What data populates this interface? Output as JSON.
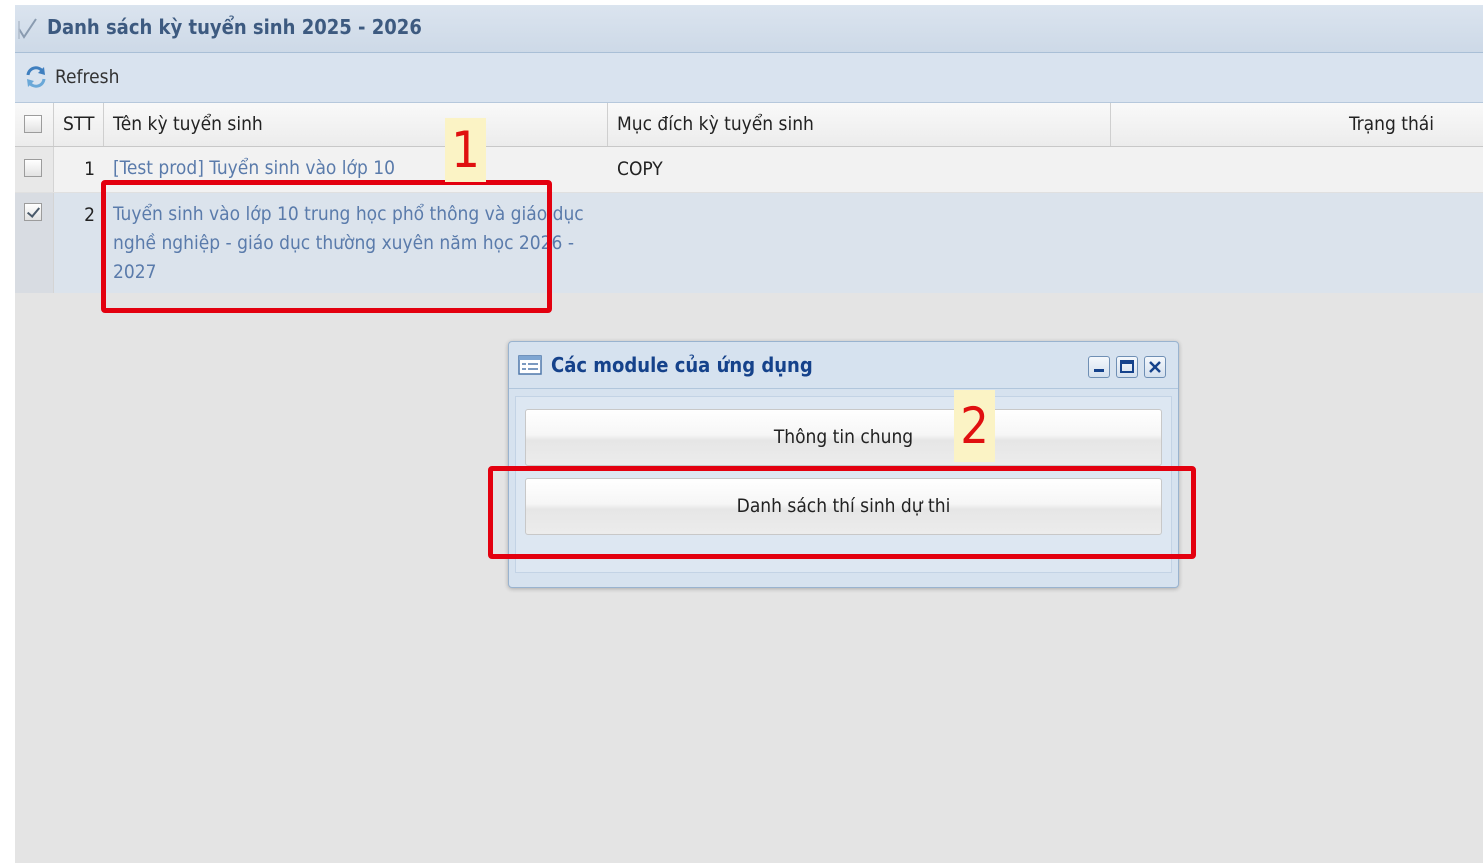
{
  "panel": {
    "title": "Danh sách kỳ tuyển sinh 2025 - 2026",
    "refresh_label": "Refresh"
  },
  "grid": {
    "columns": [
      "STT",
      "Tên kỳ tuyển sinh",
      "Mục đích kỳ tuyển sinh",
      "Trạng thái"
    ],
    "rows": [
      {
        "stt": "1",
        "name": "[Test prod] Tuyển sinh vào lớp 10",
        "purpose": "COPY",
        "checked": false
      },
      {
        "stt": "2",
        "name_lines": [
          "Tuyển sinh vào lớp 10 trung học phổ thông và giáo dục",
          "nghề nghiệp - giáo dục thường xuyên năm học 2026 -",
          "2027"
        ],
        "purpose": "",
        "checked": true
      }
    ]
  },
  "dialog": {
    "title": "Các module của ứng dụng",
    "buttons": [
      "Thông tin chung",
      "Danh sách thí sinh dự thi"
    ]
  },
  "annotations": {
    "marker_1": "1",
    "marker_2": "2",
    "highlight_color": "#e3000f"
  }
}
